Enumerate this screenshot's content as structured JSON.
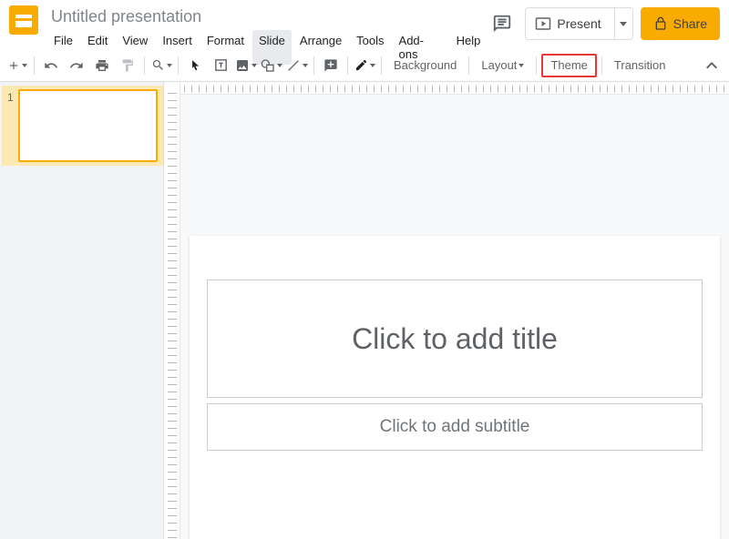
{
  "doc": {
    "title": "Untitled presentation"
  },
  "menu": {
    "file": "File",
    "edit": "Edit",
    "view": "View",
    "insert": "Insert",
    "format": "Format",
    "slide": "Slide",
    "arrange": "Arrange",
    "tools": "Tools",
    "addons": "Add-ons",
    "help": "Help"
  },
  "header": {
    "present": "Present",
    "share": "Share"
  },
  "toolbar": {
    "background": "Background",
    "layout": "Layout",
    "theme": "Theme",
    "transition": "Transition"
  },
  "sidebar": {
    "slides": [
      {
        "num": "1"
      }
    ]
  },
  "slide": {
    "title_placeholder": "Click to add title",
    "subtitle_placeholder": "Click to add subtitle"
  }
}
